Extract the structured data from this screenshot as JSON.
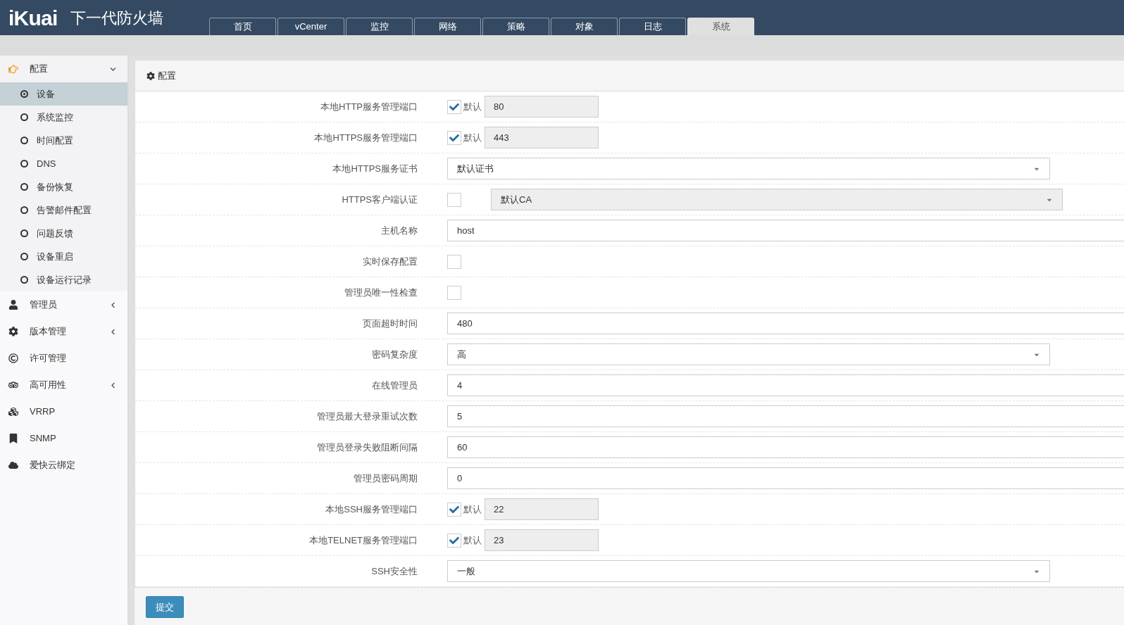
{
  "header": {
    "logo": "iKuai",
    "title": "下一代防火墙",
    "tabs": [
      {
        "label": "首页",
        "selected": false
      },
      {
        "label": "vCenter",
        "selected": false
      },
      {
        "label": "监控",
        "selected": false
      },
      {
        "label": "网络",
        "selected": false
      },
      {
        "label": "策略",
        "selected": false
      },
      {
        "label": "对象",
        "selected": false
      },
      {
        "label": "日志",
        "selected": false
      },
      {
        "label": "系统",
        "selected": true
      }
    ]
  },
  "sidebar": {
    "items": [
      {
        "label": "配置",
        "expanded": true,
        "has_children": true,
        "children": [
          {
            "label": "设备",
            "selected": true
          },
          {
            "label": "系统监控",
            "selected": false
          },
          {
            "label": "时间配置",
            "selected": false
          },
          {
            "label": "DNS",
            "selected": false
          },
          {
            "label": "备份恢复",
            "selected": false
          },
          {
            "label": "告警邮件配置",
            "selected": false
          },
          {
            "label": "问题反馈",
            "selected": false
          },
          {
            "label": "设备重启",
            "selected": false
          },
          {
            "label": "设备运行记录",
            "selected": false
          }
        ]
      },
      {
        "label": "管理员",
        "expanded": false,
        "has_children": true
      },
      {
        "label": "版本管理",
        "expanded": false,
        "has_children": true
      },
      {
        "label": "许可管理",
        "has_children": false
      },
      {
        "label": "高可用性",
        "expanded": false,
        "has_children": true
      },
      {
        "label": "VRRP",
        "has_children": false
      },
      {
        "label": "SNMP",
        "has_children": false
      },
      {
        "label": "爱快云绑定",
        "has_children": false
      }
    ]
  },
  "panel": {
    "title": "配置",
    "rows": [
      {
        "kind": "port",
        "label": "本地HTTP服务管理端口",
        "checked": true,
        "check_label": "默认",
        "value": "80"
      },
      {
        "kind": "port",
        "label": "本地HTTPS服务管理端口",
        "checked": true,
        "check_label": "默认",
        "value": "443"
      },
      {
        "kind": "select",
        "label": "本地HTTPS服务证书",
        "value": "默认证书"
      },
      {
        "kind": "check_select",
        "label": "HTTPS客户端认证",
        "checked": false,
        "value": "默认CA"
      },
      {
        "kind": "text",
        "label": "主机名称",
        "value": "host"
      },
      {
        "kind": "checkbox",
        "label": "实时保存配置",
        "checked": false
      },
      {
        "kind": "checkbox",
        "label": "管理员唯一性检查",
        "checked": false
      },
      {
        "kind": "text",
        "label": "页面超时时间",
        "value": "480"
      },
      {
        "kind": "select",
        "label": "密码复杂度",
        "value": "高"
      },
      {
        "kind": "text",
        "label": "在线管理员",
        "value": "4"
      },
      {
        "kind": "text",
        "label": "管理员最大登录重试次数",
        "value": "5"
      },
      {
        "kind": "text",
        "label": "管理员登录失败阻断间隔",
        "value": "60"
      },
      {
        "kind": "text",
        "label": "管理员密码周期",
        "value": "0"
      },
      {
        "kind": "port",
        "label": "本地SSH服务管理端口",
        "checked": true,
        "check_label": "默认",
        "value": "22"
      },
      {
        "kind": "port",
        "label": "本地TELNET服务管理端口",
        "checked": true,
        "check_label": "默认",
        "value": "23"
      },
      {
        "kind": "select",
        "label": "SSH安全性",
        "value": "一般"
      }
    ],
    "submit": "提交"
  }
}
